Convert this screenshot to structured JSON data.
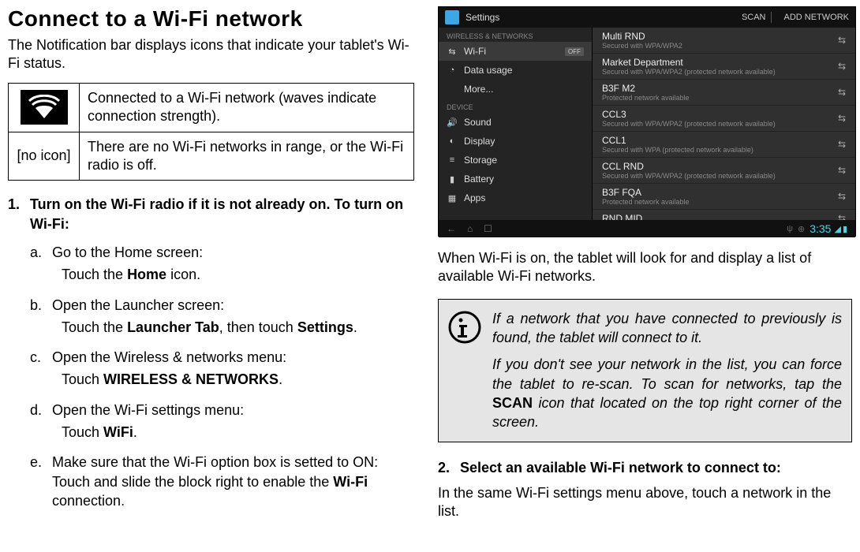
{
  "left": {
    "title": "Connect to a Wi-Fi network",
    "intro": "The Notification bar displays icons that indicate your tablet's Wi-Fi status.",
    "table": {
      "row1_text": "Connected to a Wi-Fi network (waves indicate connection strength).",
      "row2_icon": "[no icon]",
      "row2_text": "There are no Wi-Fi networks in range, or the Wi-Fi radio is off."
    },
    "step1": {
      "num": "1.",
      "text": "Turn on the Wi-Fi radio if it is not already on. To turn on Wi-Fi:",
      "items": {
        "a": {
          "letter": "a.",
          "line1": "Go to the Home screen:",
          "line2_pre": "Touch the ",
          "line2_bold": "Home",
          "line2_post": " icon."
        },
        "b": {
          "letter": "b.",
          "line1": "Open the Launcher screen:",
          "line2_pre": "Touch the ",
          "line2_bold": "Launcher Tab",
          "line2_mid": ", then touch ",
          "line2_bold2": "Settings",
          "line2_post": "."
        },
        "c": {
          "letter": "c.",
          "line1": "Open the Wireless & networks menu:",
          "line2_pre": "Touch ",
          "line2_bold": "WIRELESS & NETWORKS",
          "line2_post": "."
        },
        "d": {
          "letter": "d.",
          "line1": "Open the Wi-Fi settings menu:",
          "line2_pre": "Touch ",
          "line2_bold": "WiFi",
          "line2_post": "."
        },
        "e": {
          "letter": "e.",
          "line1_pre": "Make sure that the Wi-Fi option box is setted to ON:  Touch and slide the block right to enable the ",
          "line1_bold": "Wi-Fi",
          "line1_post": " connection."
        }
      }
    }
  },
  "screenshot": {
    "header_title": "Settings",
    "header_scan": "SCAN",
    "header_add": "ADD NETWORK",
    "section_wireless": "WIRELESS & NETWORKS",
    "item_wifi": "Wi-Fi",
    "item_wifi_toggle": "OFF",
    "item_data": "Data usage",
    "item_more": "More...",
    "section_device": "DEVICE",
    "item_sound": "Sound",
    "item_display": "Display",
    "item_storage": "Storage",
    "item_battery": "Battery",
    "item_apps": "Apps",
    "networks": [
      {
        "name": "Multi RND",
        "sub": "Secured with WPA/WPA2"
      },
      {
        "name": "Market Department",
        "sub": "Secured with WPA/WPA2 (protected network available)"
      },
      {
        "name": "B3F M2",
        "sub": "Protected network available"
      },
      {
        "name": "CCL3",
        "sub": "Secured with WPA/WPA2 (protected network available)"
      },
      {
        "name": "CCL1",
        "sub": "Secured with WPA (protected network available)"
      },
      {
        "name": "CCL RND",
        "sub": "Secured with WPA/WPA2 (protected network available)"
      },
      {
        "name": "B3F FQA",
        "sub": "Protected network available"
      },
      {
        "name": "RND MID",
        "sub": ""
      }
    ],
    "time": "3:35"
  },
  "right": {
    "after_shot": "When Wi-Fi is on, the tablet will look for and display a list of available Wi-Fi networks.",
    "note": {
      "p1": "If a network that you have connected to previously is found, the tablet will connect to it.",
      "p2_pre": "If you don't see your network in the list, you can force the tablet to re-scan. To scan for networks, tap the ",
      "p2_bold": "SCAN",
      "p2_post": " icon that located on the top right corner of the screen."
    },
    "step2": {
      "num": "2.",
      "text": "Select an available Wi-Fi network to connect to:"
    },
    "tail": "In the same Wi-Fi settings menu above, touch a network in the list."
  }
}
